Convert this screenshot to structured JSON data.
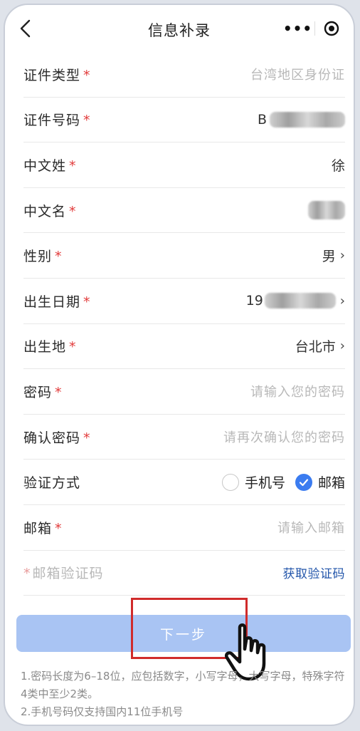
{
  "navbar": {
    "title": "信息补录",
    "more_label": "•••"
  },
  "form": {
    "id_type": {
      "label": "证件类型",
      "required": "*",
      "value": "台湾地区身份证"
    },
    "id_number": {
      "label": "证件号码",
      "required": "*",
      "value_prefix": "B"
    },
    "surname": {
      "label": "中文姓",
      "required": "*",
      "value": "徐"
    },
    "given_name": {
      "label": "中文名",
      "required": "*"
    },
    "gender": {
      "label": "性别",
      "required": "*",
      "value": "男",
      "chevron": "›"
    },
    "birth_date": {
      "label": "出生日期",
      "required": "*",
      "value_prefix": "19",
      "chevron": "›"
    },
    "birth_place": {
      "label": "出生地",
      "required": "*",
      "value": "台北市",
      "chevron": "›"
    },
    "password": {
      "label": "密码",
      "required": "*",
      "placeholder": "请输入您的密码"
    },
    "confirm_password": {
      "label": "确认密码",
      "required": "*",
      "placeholder": "请再次确认您的密码"
    },
    "verify_method": {
      "label": "验证方式",
      "options": [
        {
          "label": "手机号",
          "checked": false
        },
        {
          "label": "邮箱",
          "checked": true
        }
      ]
    },
    "email": {
      "label": "邮箱",
      "required": "*",
      "placeholder": "请输入邮箱"
    },
    "email_code": {
      "required": "*",
      "label": "邮箱验证码",
      "action": "获取验证码"
    }
  },
  "next_button": {
    "label": "下一步"
  },
  "notes": {
    "line1": "1.密码长度为6–18位，应包括数字，小写字母，大写字母，特殊字符4类中至少2类。",
    "line2": "2.手机号码仅支持国内11位手机号"
  },
  "colors": {
    "accent": "#3b7cf0",
    "button": "#a9c4f3",
    "required": "#e23b3b",
    "highlight": "#d02b2b",
    "link": "#2255aa"
  }
}
